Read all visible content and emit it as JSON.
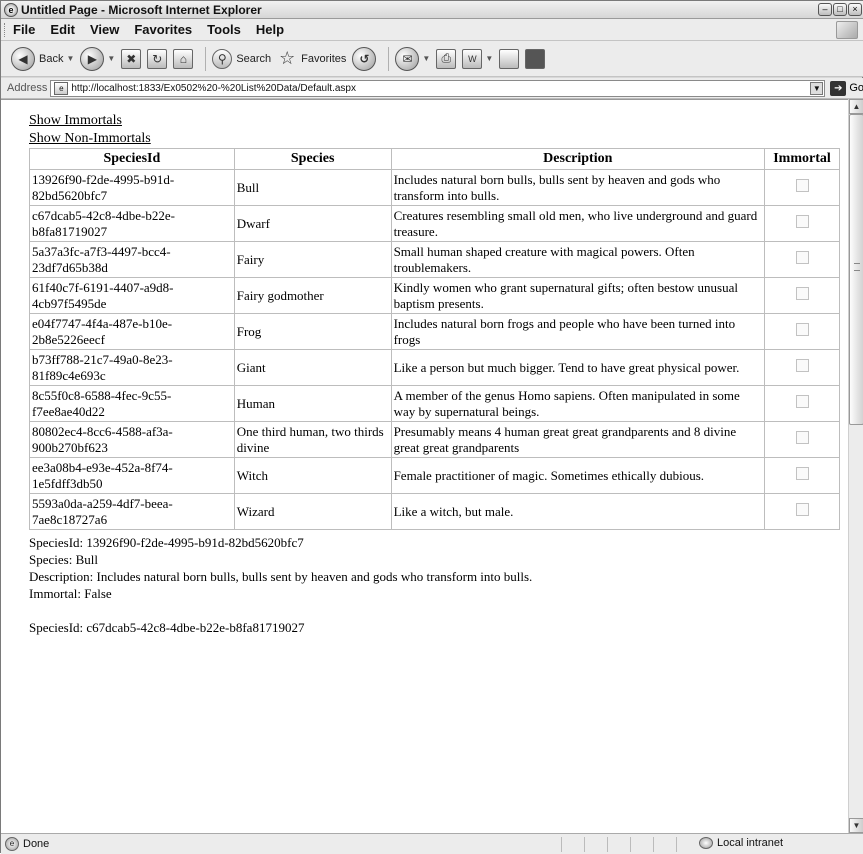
{
  "window": {
    "title": "Untitled Page - Microsoft Internet Explorer",
    "buttons": [
      "–",
      "□",
      "×"
    ]
  },
  "menu": [
    "File",
    "Edit",
    "View",
    "Favorites",
    "Tools",
    "Help"
  ],
  "toolbar": {
    "back_label": "Back",
    "search_label": "Search",
    "favorites_label": "Favorites"
  },
  "address": {
    "label": "Address",
    "url": "http://localhost:1833/Ex0502%20-%20List%20Data/Default.aspx",
    "go_label": "Go"
  },
  "links": {
    "show_immortals": "Show Immortals",
    "show_non_immortals": "Show Non-Immortals"
  },
  "table": {
    "headers": [
      "SpeciesId",
      "Species",
      "Description",
      "Immortal"
    ],
    "rows": [
      {
        "id": "13926f90-f2de-4995-b91d-82bd5620bfc7",
        "species": "Bull",
        "description": "Includes natural born bulls, bulls sent by heaven and gods who transform into bulls.",
        "immortal": false
      },
      {
        "id": "c67dcab5-42c8-4dbe-b22e-b8fa81719027",
        "species": "Dwarf",
        "description": "Creatures resembling small old men, who live underground and guard treasure.",
        "immortal": false
      },
      {
        "id": "5a37a3fc-a7f3-4497-bcc4-23df7d65b38d",
        "species": "Fairy",
        "description": "Small human shaped creature with magical powers. Often troublemakers.",
        "immortal": false
      },
      {
        "id": "61f40c7f-6191-4407-a9d8-4cb97f5495de",
        "species": "Fairy godmother",
        "description": "Kindly women who grant supernatural gifts; often bestow unusual baptism presents.",
        "immortal": false
      },
      {
        "id": "e04f7747-4f4a-487e-b10e-2b8e5226eecf",
        "species": "Frog",
        "description": "Includes natural born frogs and people who have been turned into frogs",
        "immortal": false
      },
      {
        "id": "b73ff788-21c7-49a0-8e23-81f89c4e693c",
        "species": "Giant",
        "description": "Like a person but much bigger. Tend to have great physical power.",
        "immortal": false
      },
      {
        "id": "8c55f0c8-6588-4fec-9c55-f7ee8ae40d22",
        "species": "Human",
        "description": "A member of the genus Homo sapiens. Often manipulated in some way by supernatural beings.",
        "immortal": false
      },
      {
        "id": "80802ec4-8cc6-4588-af3a-900b270bf623",
        "species": "One third human, two thirds divine",
        "description": "Presumably means 4 human great great grandparents and 8 divine great great grandparents",
        "immortal": false
      },
      {
        "id": "ee3a08b4-e93e-452a-8f74-1e5fdff3db50",
        "species": "Witch",
        "description": "Female practitioner of magic. Sometimes ethically dubious.",
        "immortal": false
      },
      {
        "id": "5593a0da-a259-4df7-beea-7ae8c18727a6",
        "species": "Wizard",
        "description": "Like a witch, but male.",
        "immortal": false
      }
    ]
  },
  "details": [
    {
      "lines": [
        "SpeciesId: 13926f90-f2de-4995-b91d-82bd5620bfc7",
        "Species: Bull",
        "Description: Includes natural born bulls, bulls sent by heaven and gods who transform into bulls.",
        "Immortal: False"
      ]
    },
    {
      "lines": [
        "SpeciesId: c67dcab5-42c8-4dbe-b22e-b8fa81719027"
      ]
    }
  ],
  "status": {
    "text": "Done",
    "zone": "Local intranet"
  }
}
